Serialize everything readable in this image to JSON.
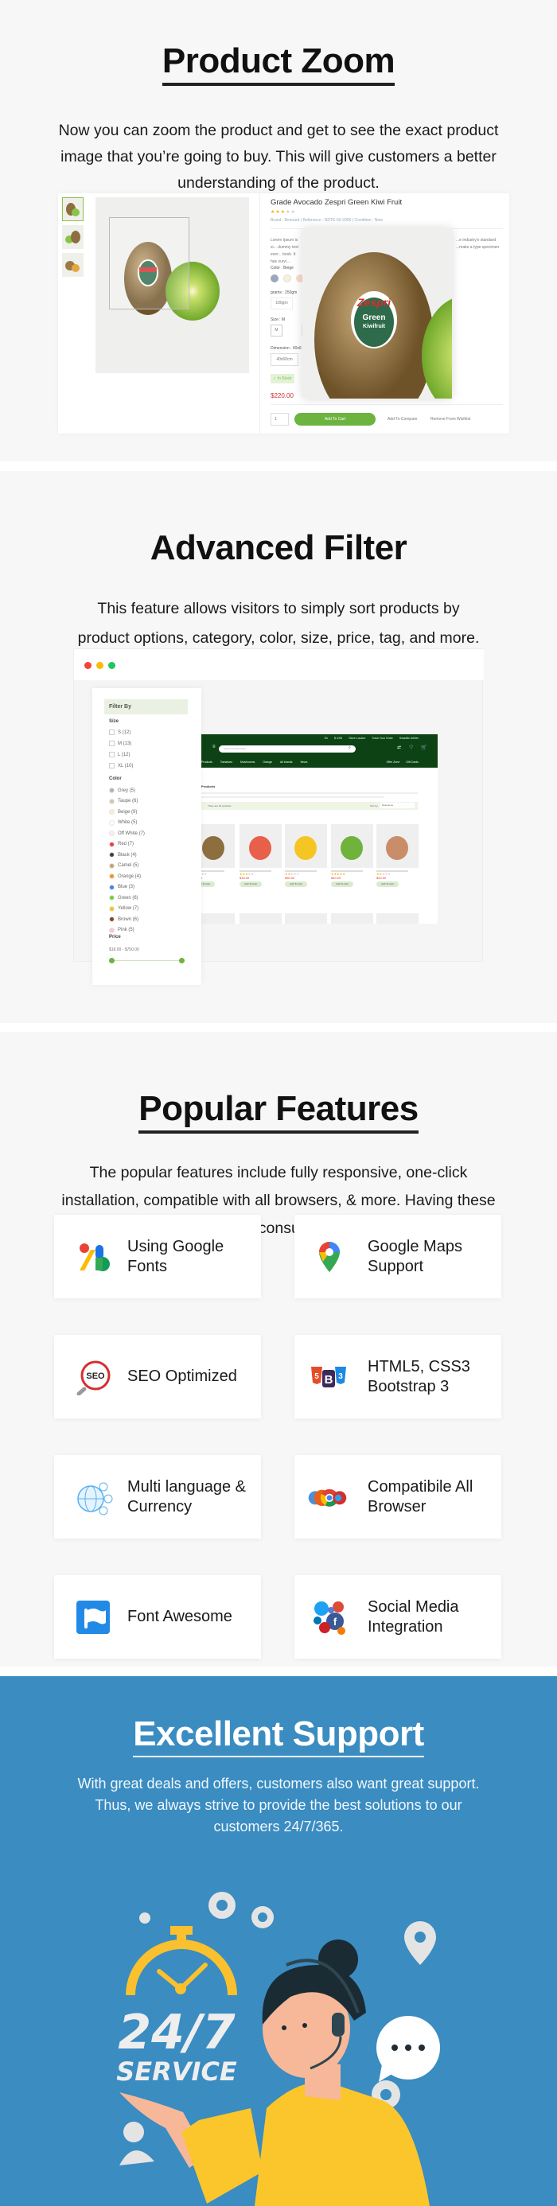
{
  "product_zoom": {
    "title": "Product Zoom",
    "description": "Now you can zoom the product and get to see the exact product image that you’re going to buy. This will give customers a better understanding of the product.",
    "product": {
      "name": "Grade Avocado Zespri Green Kiwi Fruit",
      "rating": 3,
      "meta": "Brand : Bennard  |  Reference : RDTE-50-2056  |  Condition : New",
      "desc_left": "Lorem Ipsum is si... dummy text ever... book. It has survi...",
      "desc_right": "...e industry's standard ...make a type specimen",
      "color_label": "Color : Beige",
      "grams_label": "grams : 250gm",
      "grams_option": "100gm",
      "size_label": "Size : M",
      "size_options": [
        "M",
        "L"
      ],
      "dimension_label": "Dimension : 40x6",
      "dimension_option": "40x60cm",
      "stock": "✓ In Stock",
      "price": "$220.00",
      "qty": "1",
      "add_to_cart": "Add To Cart",
      "compare": "Add To Compare",
      "wishlist": "Remove From Wishlist",
      "label_brand": "Zespri",
      "label_sub": "Green",
      "label_sub2": "Kiwifruit"
    }
  },
  "advanced_filter": {
    "title": "Advanced Filter",
    "description": "This feature allows visitors to simply sort products by product options, category, color, size, price, tag, and more.",
    "window_dots": [
      "#f44336",
      "#fbbc05",
      "#22c55e"
    ],
    "filter": {
      "heading": "Filter By",
      "size_label": "Size",
      "sizes": [
        "S (12)",
        "M (13)",
        "L (12)",
        "XL (10)"
      ],
      "color_label": "Color",
      "colors": [
        {
          "label": "Grey (5)",
          "hex": "#a8b4c0"
        },
        {
          "label": "Taupe (6)",
          "hex": "#d8c6a0"
        },
        {
          "label": "Beige (9)",
          "hex": "#f5efd6"
        },
        {
          "label": "White (5)",
          "hex": "#ffffff"
        },
        {
          "label": "Off White (7)",
          "hex": "#fbeee0"
        },
        {
          "label": "Red (7)",
          "hex": "#ef3b3b"
        },
        {
          "label": "Black (4)",
          "hex": "#3a3f4a"
        },
        {
          "label": "Camel (5)",
          "hex": "#c9a06a"
        },
        {
          "label": "Orange (4)",
          "hex": "#f7941d"
        },
        {
          "label": "Blue (3)",
          "hex": "#3b82f6"
        },
        {
          "label": "Green (6)",
          "hex": "#7ac943"
        },
        {
          "label": "Yellow (7)",
          "hex": "#f9c80e"
        },
        {
          "label": "Brown (6)",
          "hex": "#8b4513"
        },
        {
          "label": "Pink (5)",
          "hex": "#f9c6d0"
        }
      ],
      "price_label": "Price",
      "price_range": "$18.00 - $750.00"
    },
    "shop": {
      "top_links": [
        "En",
        "$ USD",
        "Store Locator",
        "Track Your Order",
        "Swadhin dehler"
      ],
      "search_placeholder": "Search Product Here",
      "nav": [
        "Products",
        "Tomatoes",
        "Mushrooms",
        "Orange",
        "All brands",
        "News"
      ],
      "nav_right": [
        "Offer Zone",
        "Gift Cards"
      ],
      "heading": "Products",
      "product_count": "There are 20 products",
      "sort_label": "Sort by:",
      "sort_value": "Relevance",
      "add_to_cart": "Add To Cart",
      "products": [
        {
          "price": "$20.00",
          "rating": 3
        },
        {
          "price": "$18.00",
          "rating": 3
        },
        {
          "price": "$50.00",
          "rating": 2
        },
        {
          "price": "$40.00",
          "rating": 5
        },
        {
          "price": "$20.00",
          "rating": 2
        }
      ]
    }
  },
  "popular_features": {
    "title": "Popular Features",
    "description": "The popular features include  fully responsive, one-click installation, compatible with all browsers, & more. Having these features will make your consumers' checkouts easier.",
    "items": [
      {
        "label": "Using Google Fonts",
        "icon": "google-fonts-icon"
      },
      {
        "label": "Google Maps Support",
        "icon": "google-maps-icon"
      },
      {
        "label": "SEO Optimized",
        "icon": "seo-icon"
      },
      {
        "label": "HTML5, CSS3 Bootstrap 3",
        "icon": "html5-css3-bootstrap-icon"
      },
      {
        "label": "Multi language & Currency",
        "icon": "globe-currency-icon"
      },
      {
        "label": "Compatibile All Browser",
        "icon": "browsers-icon"
      },
      {
        "label": "Font Awesome",
        "icon": "font-awesome-flag-icon"
      },
      {
        "label": "Social Media Integration",
        "icon": "social-media-icon"
      }
    ]
  },
  "excellent_support": {
    "title": "Excellent Support",
    "description": "With great deals and offers, customers also want great support. Thus, we always strive to provide the best solutions to our customers 24/7/365.",
    "bg_color": "#3a8cc1",
    "illustration_text": "24/7",
    "illustration_sub": "SERVICE"
  }
}
